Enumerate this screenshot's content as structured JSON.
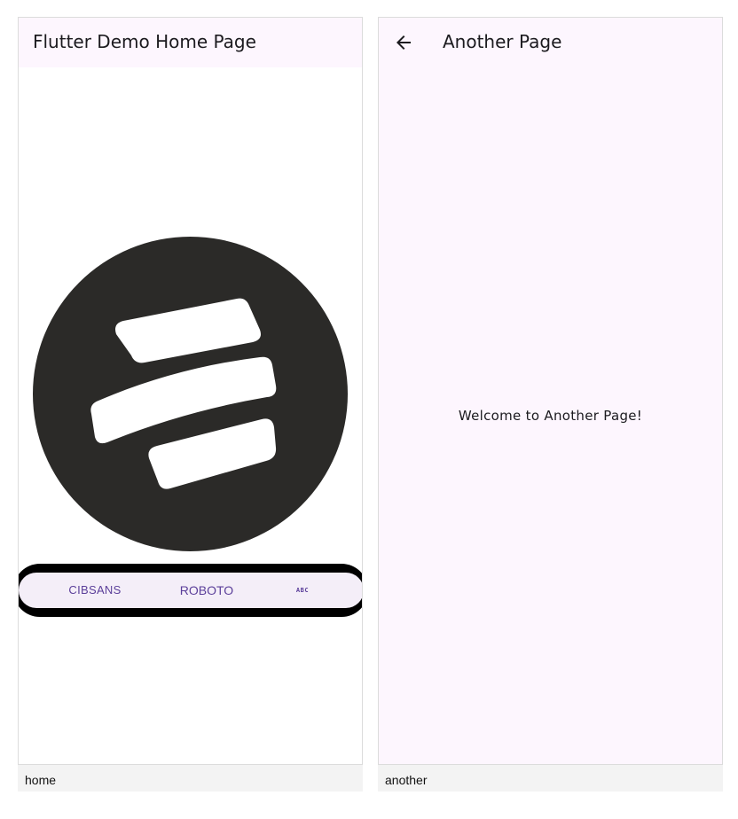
{
  "home": {
    "appbar_title": "Flutter Demo Home Page",
    "logo_icon": "three-bars-circle-logo",
    "tabs": [
      {
        "label": "CIBSANS"
      },
      {
        "label": "ROBOTO"
      },
      {
        "label": "ABC"
      }
    ],
    "caption": "home"
  },
  "another": {
    "appbar_title": "Another Page",
    "back_icon": "arrow-back-icon",
    "body_text": "Welcome to Another Page!",
    "caption": "another"
  },
  "colors": {
    "appbar_bg": "#fdf6fe",
    "page_bg": "#fdf6fe",
    "logo_circle": "#2b2a28",
    "tab_text": "#5b3f9a",
    "tabbar_bg": "#f4eef8",
    "caption_bg": "#f3f3f3"
  }
}
